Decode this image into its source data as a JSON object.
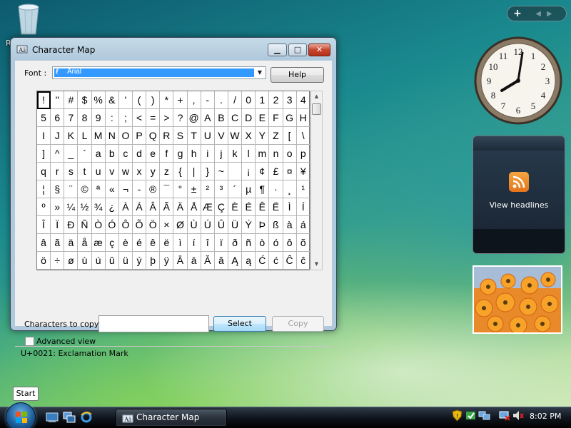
{
  "desktop": {
    "recycle_label": "R"
  },
  "window": {
    "title": "Character Map",
    "font_label": "Font :",
    "font_value": "Arial",
    "help_label": "Help",
    "chars_to_copy_label": "Characters to copy",
    "chars_to_copy_value": "",
    "select_label": "Select",
    "copy_label": "Copy",
    "advanced_label": "Advanced view",
    "status": "U+0021: Exclamation Mark"
  },
  "grid_rows": [
    [
      "!",
      "\"",
      "#",
      "$",
      "%",
      "&",
      "'",
      "(",
      ")",
      "*",
      "+",
      ",",
      "-",
      ".",
      "/",
      "0",
      "1",
      "2",
      "3",
      "4"
    ],
    [
      "5",
      "6",
      "7",
      "8",
      "9",
      ":",
      ";",
      "<",
      "=",
      ">",
      "?",
      "@",
      "A",
      "B",
      "C",
      "D",
      "E",
      "F",
      "G",
      "H"
    ],
    [
      "I",
      "J",
      "K",
      "L",
      "M",
      "N",
      "O",
      "P",
      "Q",
      "R",
      "S",
      "T",
      "U",
      "V",
      "W",
      "X",
      "Y",
      "Z",
      "[",
      "\\"
    ],
    [
      "]",
      "^",
      "_",
      "`",
      "a",
      "b",
      "c",
      "d",
      "e",
      "f",
      "g",
      "h",
      "i",
      "j",
      "k",
      "l",
      "m",
      "n",
      "o",
      "p"
    ],
    [
      "q",
      "r",
      "s",
      "t",
      "u",
      "v",
      "w",
      "x",
      "y",
      "z",
      "{",
      "|",
      "}",
      "~",
      " ",
      "¡",
      "¢",
      "£",
      "¤",
      "¥"
    ],
    [
      "¦",
      "§",
      "¨",
      "©",
      "ª",
      "«",
      "¬",
      "-",
      "®",
      "¯",
      "°",
      "±",
      "²",
      "³",
      "´",
      "µ",
      "¶",
      "·",
      "¸",
      "¹"
    ],
    [
      "º",
      "»",
      "¼",
      "½",
      "¾",
      "¿",
      "À",
      "Á",
      "Â",
      "Ã",
      "Ä",
      "Å",
      "Æ",
      "Ç",
      "È",
      "É",
      "Ê",
      "Ë",
      "Ì",
      "Í"
    ],
    [
      "Î",
      "Ï",
      "Ð",
      "Ñ",
      "Ò",
      "Ó",
      "Ô",
      "Õ",
      "Ö",
      "×",
      "Ø",
      "Ù",
      "Ú",
      "Û",
      "Ü",
      "Ý",
      "Þ",
      "ß",
      "à",
      "á"
    ],
    [
      "â",
      "ã",
      "ä",
      "å",
      "æ",
      "ç",
      "è",
      "é",
      "ê",
      "ë",
      "ì",
      "í",
      "î",
      "ï",
      "ð",
      "ñ",
      "ò",
      "ó",
      "ô",
      "õ"
    ],
    [
      "ö",
      "÷",
      "ø",
      "ù",
      "ú",
      "û",
      "ü",
      "ý",
      "þ",
      "ÿ",
      "Ā",
      "ā",
      "Ă",
      "ă",
      "Ą",
      "ą",
      "Ć",
      "ć",
      "Ĉ",
      "ĉ"
    ]
  ],
  "gadgets": {
    "feed_label": "View headlines",
    "clock_numbers": [
      "12",
      "1",
      "2",
      "3",
      "4",
      "5",
      "6",
      "7",
      "8",
      "9",
      "10",
      "11"
    ]
  },
  "taskbar": {
    "start_tooltip": "Start",
    "task_title": "Character Map",
    "time": "8:02 PM"
  },
  "icons": [
    "recycle-bin-icon",
    "charmap-icon",
    "rss-icon",
    "windows-logo-icon",
    "show-desktop-icon",
    "switch-windows-icon",
    "ie-icon",
    "shield-icon",
    "network-icon",
    "volume-icon"
  ]
}
